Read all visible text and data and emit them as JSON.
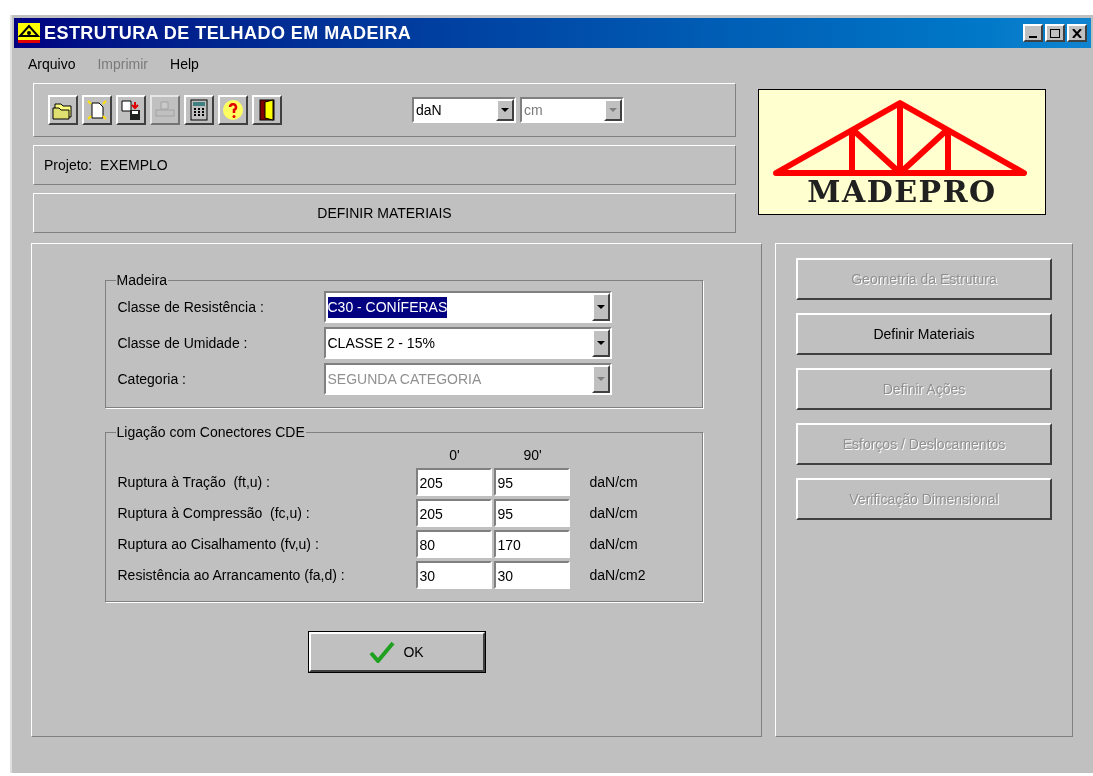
{
  "window": {
    "title": "ESTRUTURA DE TELHADO EM MADEIRA"
  },
  "menu": [
    {
      "label": "Arquivo",
      "disabled": false
    },
    {
      "label": "Imprimir",
      "disabled": true
    },
    {
      "label": "Help",
      "disabled": false
    }
  ],
  "toolbar": [
    {
      "kind": "open",
      "disabled": false
    },
    {
      "kind": "new",
      "disabled": false
    },
    {
      "kind": "save",
      "disabled": false
    },
    {
      "kind": "print",
      "disabled": true
    },
    {
      "kind": "calculator",
      "disabled": false
    },
    {
      "kind": "help",
      "disabled": false
    },
    {
      "kind": "exit",
      "disabled": false
    }
  ],
  "units": [
    {
      "value": "daN",
      "disabled": false
    },
    {
      "value": "cm",
      "disabled": true
    }
  ],
  "project": "Projeto:  EXEMPLO",
  "section_title": "DEFINIR MATERIAIS",
  "logo": "MADEPRO",
  "wood": {
    "legend": "Madeira",
    "fields": [
      {
        "label": "Classe de Resistência :",
        "value": "C30 - CONÍFERAS",
        "selected": true,
        "disabled": false
      },
      {
        "label": "Classe de Umidade :",
        "value": "CLASSE 2 - 15%",
        "selected": false,
        "disabled": false
      },
      {
        "label": "Categoria :",
        "value": "SEGUNDA CATEGORIA",
        "selected": false,
        "disabled": true
      }
    ]
  },
  "connectors": {
    "legend": "Ligação com Conectores CDE",
    "columns": [
      "0'",
      "90'"
    ],
    "rows": [
      {
        "label": "Ruptura à Tração  (ft,u) :",
        "values": [
          "205",
          "95"
        ],
        "unit": "daN/cm"
      },
      {
        "label": "Ruptura à Compressão  (fc,u) :",
        "values": [
          "205",
          "95"
        ],
        "unit": "daN/cm"
      },
      {
        "label": "Ruptura ao Cisalhamento (fv,u) :",
        "values": [
          "80",
          "170"
        ],
        "unit": "daN/cm"
      },
      {
        "label": "Resistência ao Arrancamento (fa,d) :",
        "values": [
          "30",
          "30"
        ],
        "unit": "daN/cm2"
      }
    ]
  },
  "ok_button": "OK",
  "steps": [
    {
      "label": "Geometria da Estrutura",
      "disabled": true
    },
    {
      "label": "Definir Materiais",
      "disabled": false
    },
    {
      "label": "Definir Ações",
      "disabled": true
    },
    {
      "label": "Esforços / Deslocamentos",
      "disabled": true
    },
    {
      "label": "Verificação Dimensional",
      "disabled": true
    }
  ]
}
